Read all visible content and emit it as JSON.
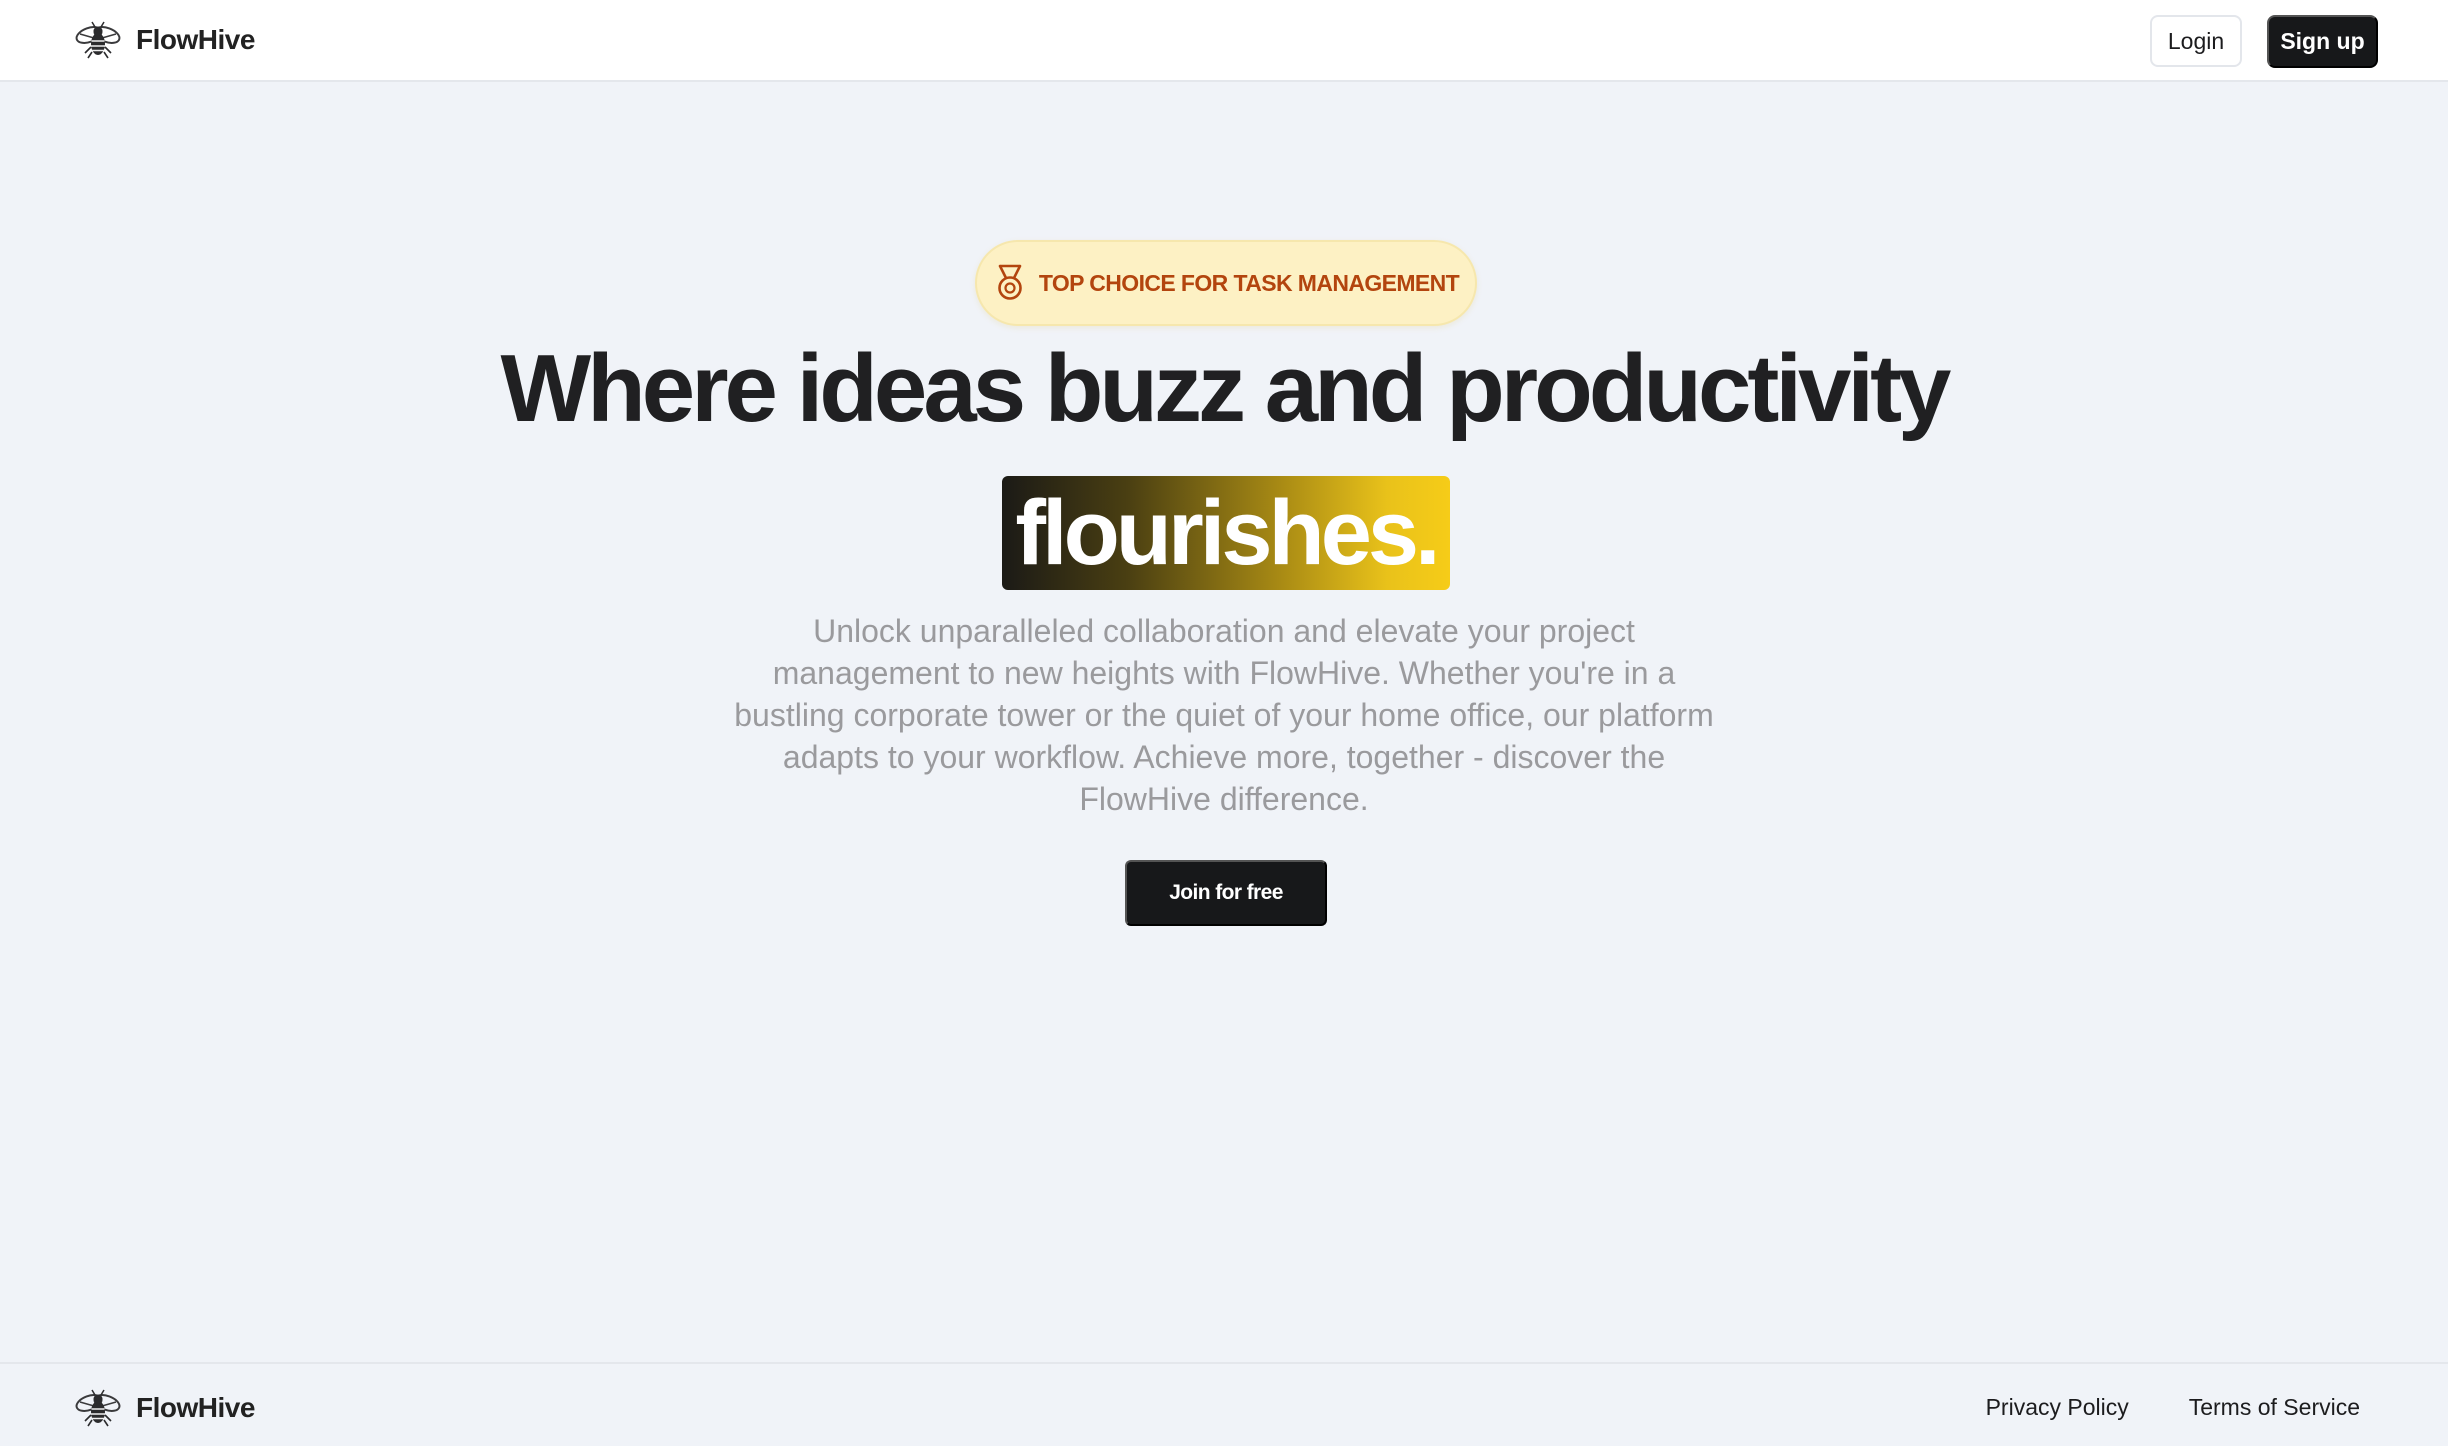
{
  "header": {
    "brand_name": "FlowHive",
    "logo_icon": "bee-icon",
    "login_label": "Login",
    "signup_label": "Sign up"
  },
  "hero": {
    "badge_icon": "medal-icon",
    "badge_text": "TOP CHOICE FOR TASK MANAGEMENT",
    "headline": "Where ideas buzz and productivity",
    "highlight": "flourishes.",
    "description": "Unlock unparalleled collaboration and elevate your project management to new heights with FlowHive. Whether you're in a bustling corporate tower or the quiet of your home office, our platform adapts to your workflow. Achieve more, together - discover the FlowHive difference.",
    "cta_label": "Join for free"
  },
  "footer": {
    "brand_name": "FlowHive",
    "links": [
      "Privacy Policy",
      "Terms of Service"
    ]
  },
  "colors": {
    "page_background": "#f0f3f8",
    "primary_button": "#17181a",
    "badge_background": "#fdf1c4",
    "badge_text": "#b3450e",
    "highlight_gradient_start": "#1b1a16",
    "highlight_gradient_end": "#f6cc18"
  }
}
